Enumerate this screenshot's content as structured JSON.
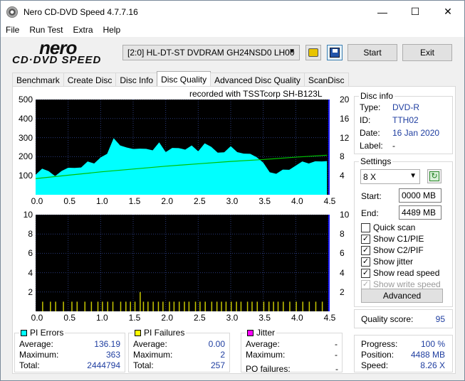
{
  "window": {
    "title": "Nero CD-DVD Speed 4.7.7.16",
    "controls": {
      "minimize": "—",
      "maximize": "☐",
      "close": "✕"
    }
  },
  "menu": [
    "File",
    "Run Test",
    "Extra",
    "Help"
  ],
  "toolbar": {
    "logo_top": "nero",
    "logo_bottom": "CD·DVD SPEED",
    "drive": "[2:0]   HL-DT-ST DVDRAM GH24NSD0 LH00",
    "start_label": "Start",
    "exit_label": "Exit"
  },
  "tabs": [
    "Benchmark",
    "Create Disc",
    "Disc Info",
    "Disc Quality",
    "Advanced Disc Quality",
    "ScanDisc"
  ],
  "active_tab": "Disc Quality",
  "disc_info": {
    "title": "Disc info",
    "rows": [
      {
        "label": "Type:",
        "value": "DVD-R"
      },
      {
        "label": "ID:",
        "value": "TTH02"
      },
      {
        "label": "Date:",
        "value": "16 Jan 2020"
      },
      {
        "label": "Label:",
        "value": "-"
      }
    ]
  },
  "settings": {
    "title": "Settings",
    "speed": "8 X",
    "start_label": "Start:",
    "start_value": "0000 MB",
    "end_label": "End:",
    "end_value": "4489 MB",
    "checks": [
      {
        "label": "Quick scan",
        "checked": false,
        "enabled": true
      },
      {
        "label": "Show C1/PIE",
        "checked": true,
        "enabled": true
      },
      {
        "label": "Show C2/PIF",
        "checked": true,
        "enabled": true
      },
      {
        "label": "Show jitter",
        "checked": true,
        "enabled": true
      },
      {
        "label": "Show read speed",
        "checked": true,
        "enabled": true
      },
      {
        "label": "Show write speed",
        "checked": true,
        "enabled": false
      }
    ],
    "advanced_label": "Advanced"
  },
  "quality": {
    "label": "Quality score:",
    "value": "95"
  },
  "progress": {
    "rows": [
      {
        "label": "Progress:",
        "value": "100 %"
      },
      {
        "label": "Position:",
        "value": "4488 MB"
      },
      {
        "label": "Speed:",
        "value": "8.26 X"
      }
    ]
  },
  "stats": {
    "pi_errors": {
      "title": "PI Errors",
      "color": "#00ffff",
      "rows": [
        {
          "label": "Average:",
          "value": "136.19"
        },
        {
          "label": "Maximum:",
          "value": "363"
        },
        {
          "label": "Total:",
          "value": "2444794"
        }
      ]
    },
    "pi_failures": {
      "title": "PI Failures",
      "color": "#ffff00",
      "rows": [
        {
          "label": "Average:",
          "value": "0.00"
        },
        {
          "label": "Maximum:",
          "value": "2"
        },
        {
          "label": "Total:",
          "value": "257"
        }
      ]
    },
    "jitter": {
      "title": "Jitter",
      "color": "#ff00ff",
      "rows": [
        {
          "label": "Average:",
          "value": "-"
        },
        {
          "label": "Maximum:",
          "value": "-"
        }
      ]
    },
    "po_failures": {
      "label": "PO failures:",
      "value": "-"
    }
  },
  "chart_data": [
    {
      "type": "area",
      "title": "recorded with TSSTcorp SH-B123L",
      "xlabel": "",
      "ylabel": "PI Errors",
      "xlim": [
        0,
        4.5
      ],
      "ylim": [
        0,
        500
      ],
      "y2lim": [
        0,
        20
      ],
      "xticks": [
        "0.0",
        "0.5",
        "1.0",
        "1.5",
        "2.0",
        "2.5",
        "3.0",
        "3.5",
        "4.0",
        "4.5"
      ],
      "yticks": [
        "100",
        "200",
        "300",
        "400",
        "500"
      ],
      "y2ticks": [
        "4",
        "8",
        "12",
        "16",
        "20"
      ],
      "grid": true,
      "series": [
        {
          "name": "PI Errors",
          "color": "#00ffff",
          "x": [
            0,
            0.1,
            0.2,
            0.3,
            0.4,
            0.5,
            0.6,
            0.7,
            0.8,
            0.9,
            1.0,
            1.1,
            1.2,
            1.3,
            1.4,
            1.5,
            1.6,
            1.7,
            1.8,
            1.9,
            2.0,
            2.1,
            2.2,
            2.3,
            2.4,
            2.5,
            2.6,
            2.7,
            2.8,
            2.9,
            3.0,
            3.1,
            3.2,
            3.3,
            3.4,
            3.5,
            3.6,
            3.7,
            3.8,
            3.9,
            4.0,
            4.1,
            4.2,
            4.3,
            4.4,
            4.48
          ],
          "values": [
            120,
            140,
            115,
            110,
            125,
            130,
            150,
            140,
            160,
            170,
            190,
            230,
            300,
            250,
            260,
            240,
            230,
            250,
            230,
            260,
            230,
            240,
            260,
            240,
            250,
            240,
            270,
            240,
            230,
            220,
            240,
            230,
            210,
            230,
            200,
            160,
            130,
            110,
            120,
            140,
            150,
            160,
            170,
            170,
            190,
            180
          ]
        },
        {
          "name": "Read Speed",
          "color": "#00c000",
          "x": [
            0,
            0.5,
            1.0,
            1.5,
            2.0,
            2.5,
            3.0,
            3.5,
            4.0,
            4.48
          ],
          "values": [
            3.4,
            4.1,
            4.8,
            5.4,
            6.0,
            6.5,
            7.0,
            7.4,
            7.9,
            8.3
          ]
        }
      ]
    },
    {
      "type": "bar",
      "ylabel": "PI Failures",
      "xlim": [
        0,
        4.5
      ],
      "ylim": [
        0,
        10
      ],
      "y2lim": [
        0,
        10
      ],
      "xticks": [
        "0.0",
        "0.5",
        "1.0",
        "1.5",
        "2.0",
        "2.5",
        "3.0",
        "3.5",
        "4.0",
        "4.5"
      ],
      "yticks": [
        "2",
        "4",
        "6",
        "8",
        "10"
      ],
      "y2ticks": [
        "2",
        "4",
        "6",
        "8",
        "10"
      ],
      "grid": true,
      "series": [
        {
          "name": "PI Failures",
          "color": "#c8c800",
          "x": [
            0.1,
            0.22,
            0.3,
            0.42,
            0.55,
            0.63,
            0.75,
            0.85,
            0.95,
            1.02,
            1.1,
            1.18,
            1.3,
            1.38,
            1.45,
            1.52,
            1.6,
            1.65,
            1.72,
            1.8,
            1.88,
            1.95,
            2.05,
            2.12,
            2.2,
            2.28,
            2.35,
            2.45,
            2.52,
            2.6,
            2.7,
            2.78,
            2.85,
            2.92,
            3.0,
            3.08,
            3.15,
            3.25,
            3.32,
            3.4,
            3.5,
            3.58,
            3.65,
            3.72,
            3.8,
            3.9,
            4.0,
            4.1,
            4.2,
            4.3,
            4.4
          ],
          "values": [
            1,
            1,
            1,
            1,
            1,
            1,
            1,
            1,
            1,
            1,
            1,
            1,
            1,
            1,
            1,
            1,
            2,
            1,
            1,
            1,
            1,
            1,
            1,
            1,
            1,
            1,
            1,
            1,
            1,
            1,
            1,
            1,
            1,
            1,
            1,
            1,
            1,
            1,
            1,
            1,
            1,
            1,
            1,
            1,
            1,
            1,
            1,
            1,
            1,
            1,
            1
          ]
        }
      ]
    }
  ]
}
